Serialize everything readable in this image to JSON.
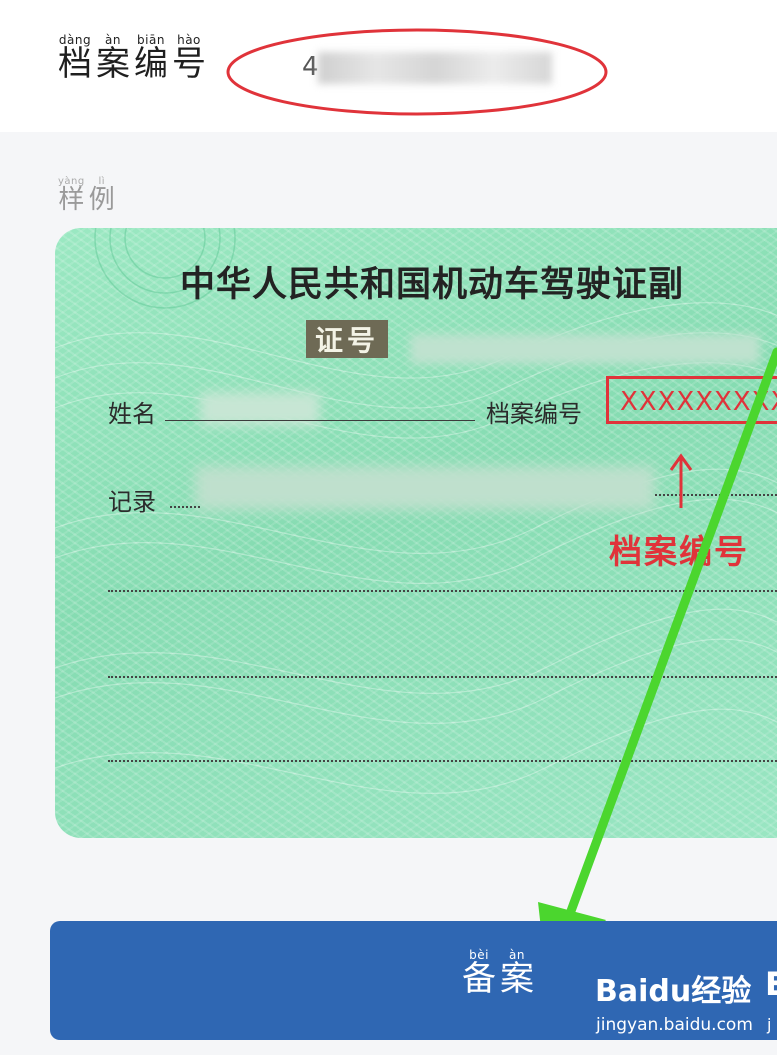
{
  "form": {
    "archive_field": {
      "label_chars": [
        {
          "pinyin": "dàng",
          "hanzi": "档"
        },
        {
          "pinyin": "àn",
          "hanzi": "案"
        },
        {
          "pinyin": "biān",
          "hanzi": "编"
        },
        {
          "pinyin": "hào",
          "hanzi": "号"
        }
      ],
      "value_visible": "4"
    },
    "sample_label_chars": [
      {
        "pinyin": "yàng",
        "hanzi": "样"
      },
      {
        "pinyin": "lì",
        "hanzi": "例"
      }
    ],
    "submit_button_chars": [
      {
        "pinyin": "bèi",
        "hanzi": "备"
      },
      {
        "pinyin": "àn",
        "hanzi": "案"
      }
    ]
  },
  "sample_card": {
    "title": "中华人民共和国机动车驾驶证副",
    "id_label": "证号",
    "name_label": "姓名",
    "archive_label": "档案编号",
    "record_label": "记录",
    "archive_highlight_text": "XXXXXXXXX",
    "arrow_char": "↑",
    "red_caption": "档案编号"
  },
  "watermark": {
    "logo_text": "Baidu经验",
    "url_text": "jingyan.baidu.com",
    "edge_letter": "E",
    "edge_small": "j"
  },
  "colors": {
    "button_bg": "#2f67b3",
    "annotation_red": "#e0333a",
    "annotation_green": "#4bd62e",
    "card_green": "#8fe2b9"
  },
  "icons": [
    "oval-highlight",
    "green-arrow-icon",
    "up-arrow-icon"
  ]
}
